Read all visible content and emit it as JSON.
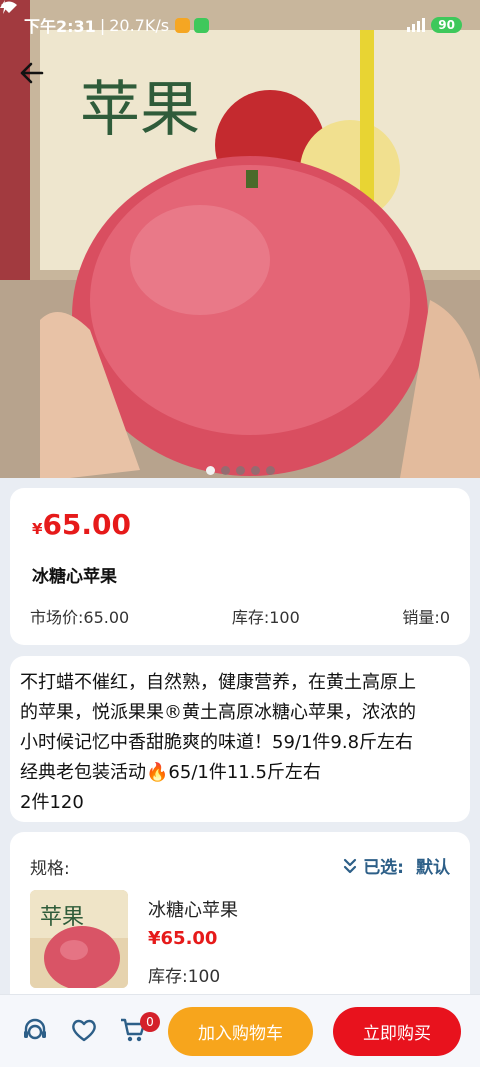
{
  "status_bar": {
    "time": "下午2:31",
    "separator": "|",
    "net_speed": "20.7K/s",
    "battery": "90"
  },
  "gallery": {
    "image_count": 5,
    "active_index": 0
  },
  "product": {
    "currency": "¥",
    "price": "65.00",
    "name": "冰糖心苹果",
    "market_price": "市场价:65.00",
    "stock": "库存:100",
    "sales": "销量:0"
  },
  "description": {
    "line1": "不打蜡不催红，自然熟，健康营养，在黄土高原上",
    "line2": "的苹果，悦派果果®黄土高原冰糖心苹果，浓浓的",
    "line3": "小时候记忆中香甜脆爽的味道！59/1件9.8斤左右",
    "line4": "经典老包装活动🔥65/1件11.5斤左右",
    "line5": "2件120"
  },
  "spec": {
    "label": "规格:",
    "selected_label": "已选:",
    "selected_value": "默认",
    "item_name": "冰糖心苹果",
    "item_price": "¥65.00",
    "item_stock": "库存:100"
  },
  "bottom_bar": {
    "cart_count": "0",
    "add_to_cart": "加入购物车",
    "buy_now": "立即购买"
  },
  "colors": {
    "price_red": "#e61a1a",
    "cart_orange": "#f7a51c",
    "buy_red": "#e8121d",
    "spec_blue": "#2d5f88"
  }
}
